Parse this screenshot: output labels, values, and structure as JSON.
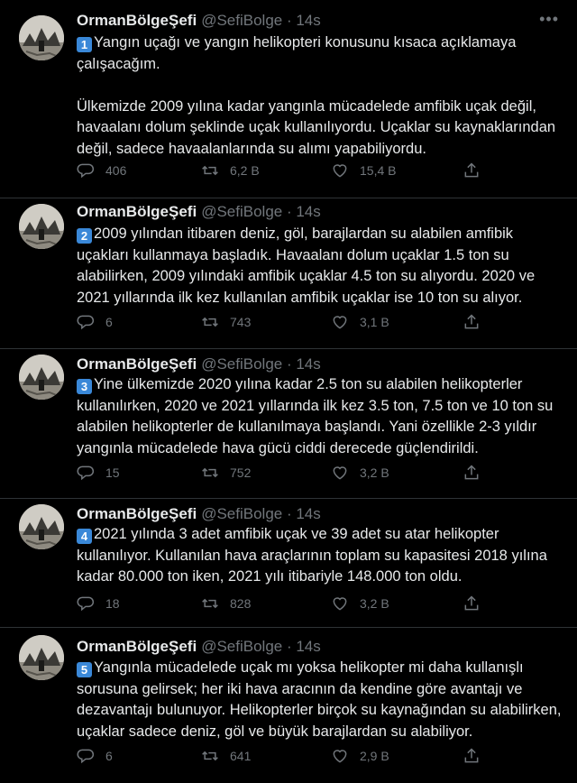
{
  "tweets": [
    {
      "name": "OrmanBölgeŞefi",
      "handle": "@SefiBolge",
      "time": "14s",
      "number": "1",
      "text": "Yangın uçağı ve yangın helikopteri konusunu kısaca açıklamaya çalışacağım.\n\nÜlkemizde 2009 yılına kadar yangınla mücadelede amfibik uçak değil, havaalanı dolum şeklinde uçak kullanılıyordu. Uçaklar su kaynaklarından değil, sadece havaalanlarında su alımı yapabiliyordu.",
      "replies": "406",
      "retweets": "6,2 B",
      "likes": "15,4 B"
    },
    {
      "name": "OrmanBölgeŞefi",
      "handle": "@SefiBolge",
      "time": "14s",
      "number": "2",
      "text": "2009 yılından itibaren deniz, göl, barajlardan su alabilen amfibik uçakları kullanmaya başladık. Havaalanı dolum uçaklar 1.5 ton su alabilirken, 2009 yılındaki amfibik uçaklar 4.5 ton su alıyordu. 2020 ve 2021 yıllarında ilk kez kullanılan amfibik uçaklar ise 10 ton su alıyor.",
      "replies": "6",
      "retweets": "743",
      "likes": "3,1 B"
    },
    {
      "name": "OrmanBölgeŞefi",
      "handle": "@SefiBolge",
      "time": "14s",
      "number": "3",
      "text": "Yine ülkemizde 2020 yılına kadar 2.5 ton su alabilen helikopterler kullanılırken, 2020 ve 2021 yıllarında ilk kez 3.5 ton, 7.5 ton ve 10 ton su alabilen helikopterler de kullanılmaya başlandı. Yani özellikle 2-3 yıldır yangınla mücadelede hava gücü ciddi derecede güçlendirildi.",
      "replies": "15",
      "retweets": "752",
      "likes": "3,2 B"
    },
    {
      "name": "OrmanBölgeŞefi",
      "handle": "@SefiBolge",
      "time": "14s",
      "number": "4",
      "text": "2021 yılında 3 adet amfibik uçak ve 39 adet su atar helikopter kullanılıyor. Kullanılan hava araçlarının toplam su kapasitesi 2018 yılına kadar 80.000 ton iken, 2021 yılı itibariyle 148.000 ton oldu.",
      "replies": "18",
      "retweets": "828",
      "likes": "3,2 B"
    },
    {
      "name": "OrmanBölgeŞefi",
      "handle": "@SefiBolge",
      "time": "14s",
      "number": "5",
      "text": "Yangınla mücadelede uçak mı yoksa helikopter mi daha kullanışlı sorusuna gelirsek; her iki hava aracının da kendine göre avantajı ve dezavantajı bulunuyor. Helikopterler birçok su kaynağından su alabilirken, uçaklar sadece deniz, göl ve büyük barajlardan su alabiliyor.",
      "replies": "6",
      "retweets": "641",
      "likes": "2,9 B"
    }
  ],
  "icons": {
    "reply": "reply-icon",
    "retweet": "retweet-icon",
    "like": "heart-icon",
    "share": "share-icon",
    "more": "more-icon",
    "number_badge_color": "#3a88d8"
  }
}
